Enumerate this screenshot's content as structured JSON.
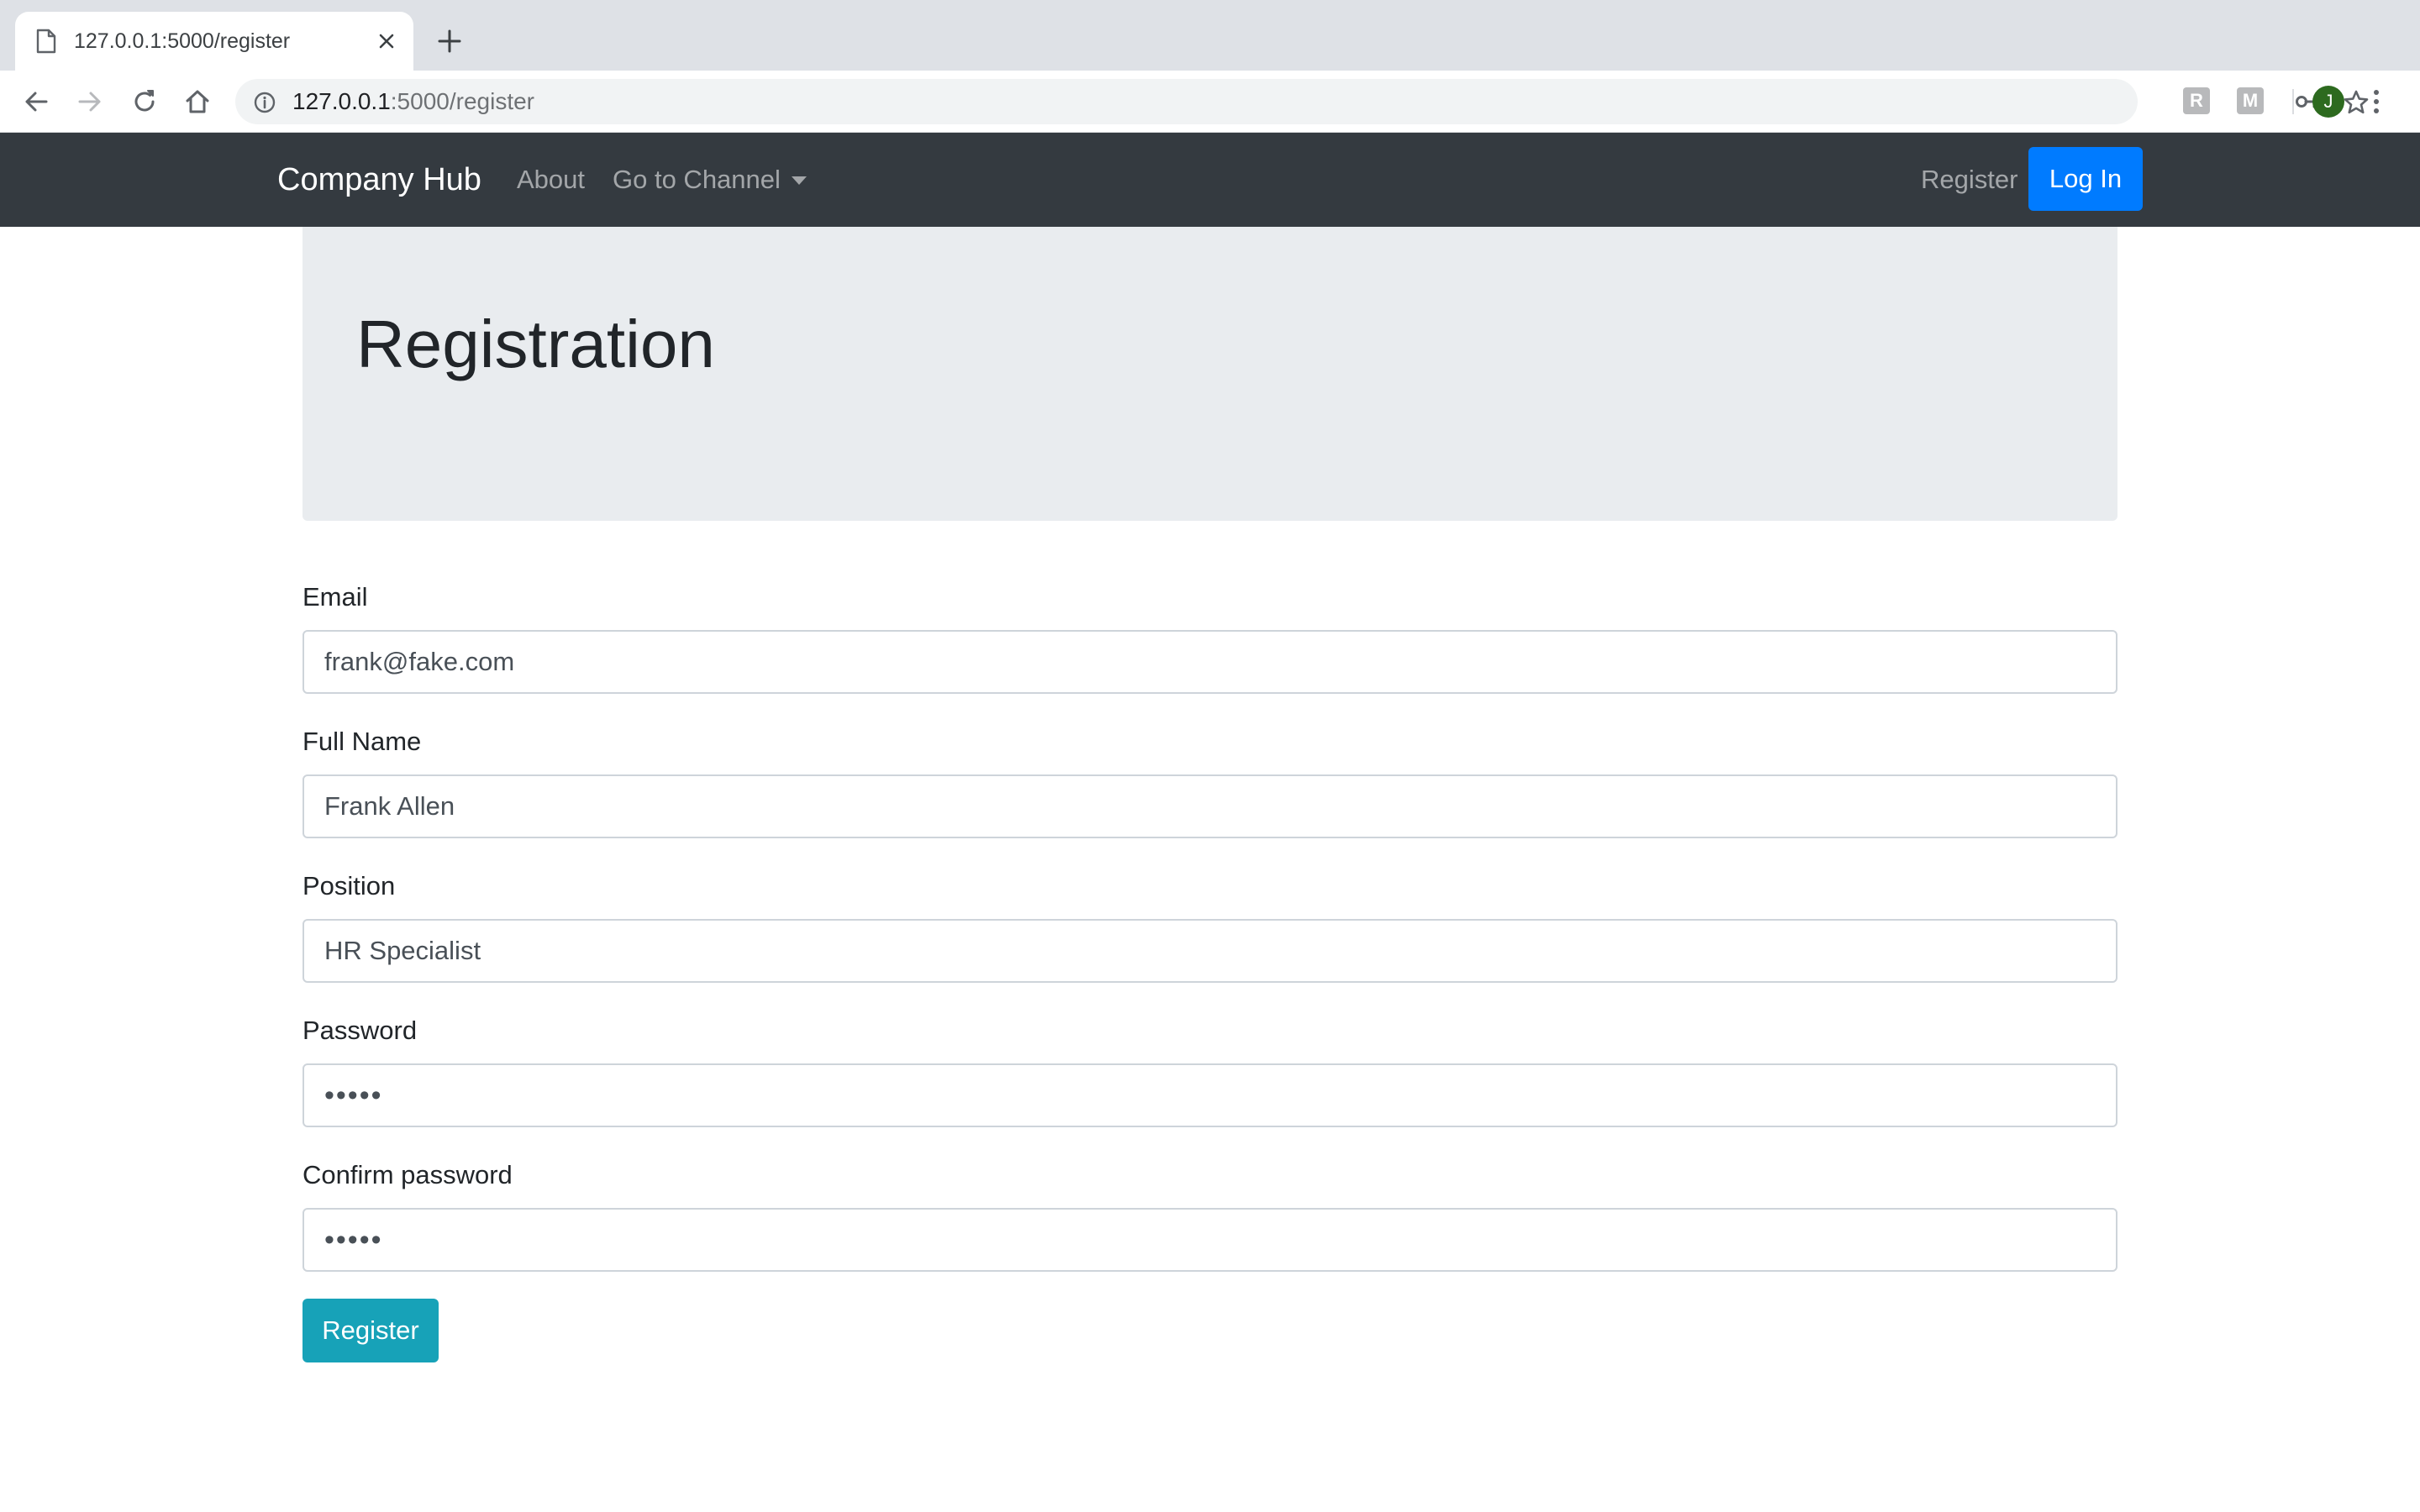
{
  "browser": {
    "tab": {
      "title": "127.0.0.1:5000/register"
    },
    "address_bar": {
      "host": "127.0.0.1",
      "path": ":5000/register"
    },
    "extensions": [
      "R",
      "M"
    ],
    "profile_initial": "J"
  },
  "navbar": {
    "brand": "Company Hub",
    "links": {
      "about": "About",
      "channel": "Go to Channel",
      "register": "Register"
    },
    "login_button": "Log In",
    "background_color": "#343a40",
    "login_color": "#007bff"
  },
  "page": {
    "title": "Registration",
    "form": {
      "email": {
        "label": "Email",
        "value": "frank@fake.com"
      },
      "full_name": {
        "label": "Full Name",
        "value": "Frank Allen"
      },
      "position": {
        "label": "Position",
        "value": "HR Specialist"
      },
      "password": {
        "label": "Password",
        "value": "•••••"
      },
      "confirm_password": {
        "label": "Confirm password",
        "value": "•••••"
      },
      "submit_label": "Register",
      "submit_color": "#17a2b8"
    }
  }
}
